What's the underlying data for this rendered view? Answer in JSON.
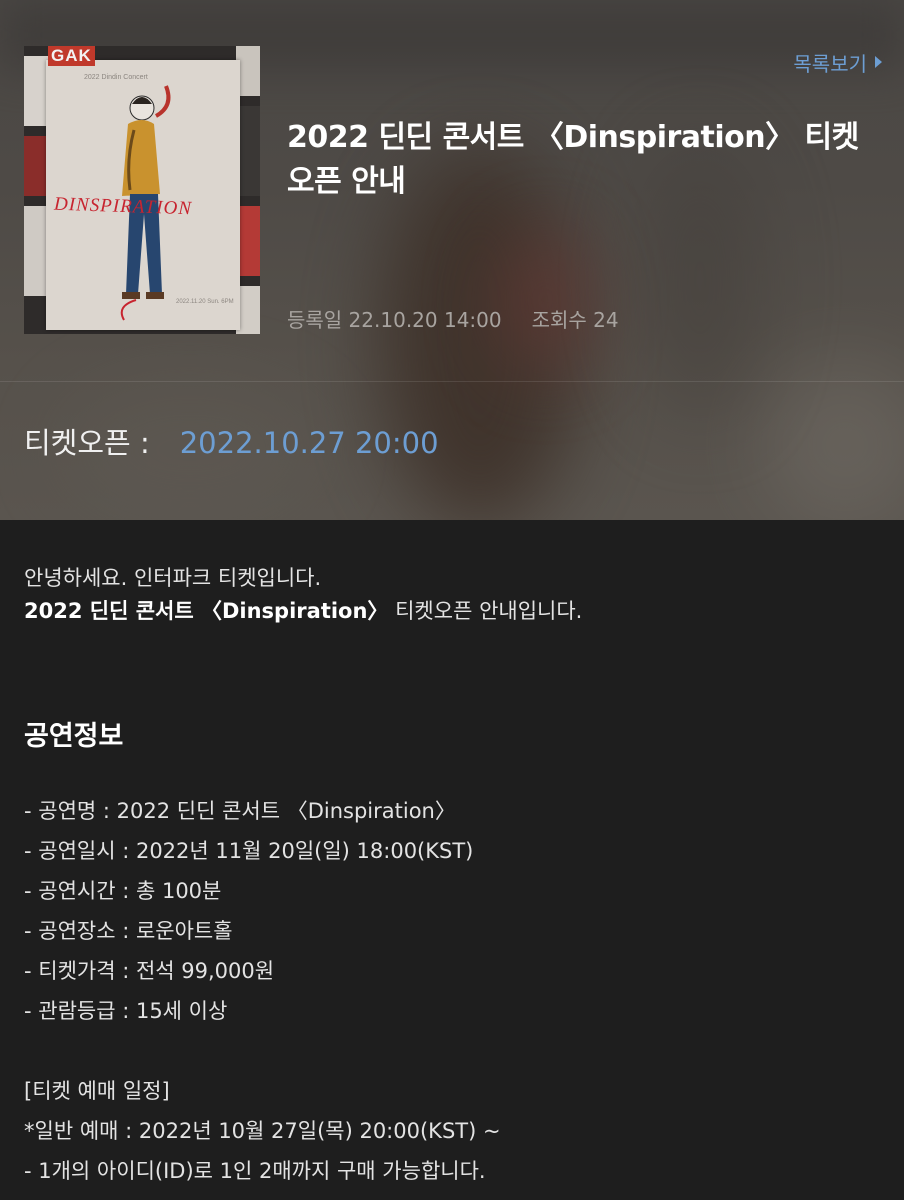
{
  "header": {
    "list_link": "목록보기",
    "title": "2022 딘딘 콘서트 〈Dinspiration〉 티켓 오픈 안내",
    "registered": "등록일 22.10.20 14:00",
    "views": "조회수 24",
    "ticket_open_label": "티켓오픈 :",
    "ticket_open_value": "2022.10.27 20:00"
  },
  "poster": {
    "top_sign": "GAK",
    "small_text": "2022 Dindin Concert",
    "logo_text": "DINSPIRATION",
    "bottom_text": "2022.11.20 Sun. 6PM"
  },
  "body": {
    "greeting_line1": "안녕하세요. 인터파크 티켓입니다.",
    "greeting_line2_bold": "2022 딘딘 콘서트 〈Dinspiration〉",
    "greeting_line2_rest": " 티켓오픈 안내입니다.",
    "section_title": "공연정보",
    "info": [
      "- 공연명 : 2022 딘딘 콘서트 〈Dinspiration〉",
      "- 공연일시 : 2022년 11월 20일(일) 18:00(KST)",
      "- 공연시간 : 총 100분",
      "- 공연장소 : 로운아트홀",
      "- 티켓가격 : 전석 99,000원",
      "- 관람등급 : 15세 이상"
    ],
    "schedule": [
      "[티켓 예매 일정]",
      "*일반 예매 : 2022년 10월 27일(목) 20:00(KST) ~",
      "- 1개의 아이디(ID)로 1인 2매까지 구매 가능합니다."
    ]
  },
  "colors": {
    "accent": "#6d9ed3",
    "background": "#1e1e1e"
  }
}
